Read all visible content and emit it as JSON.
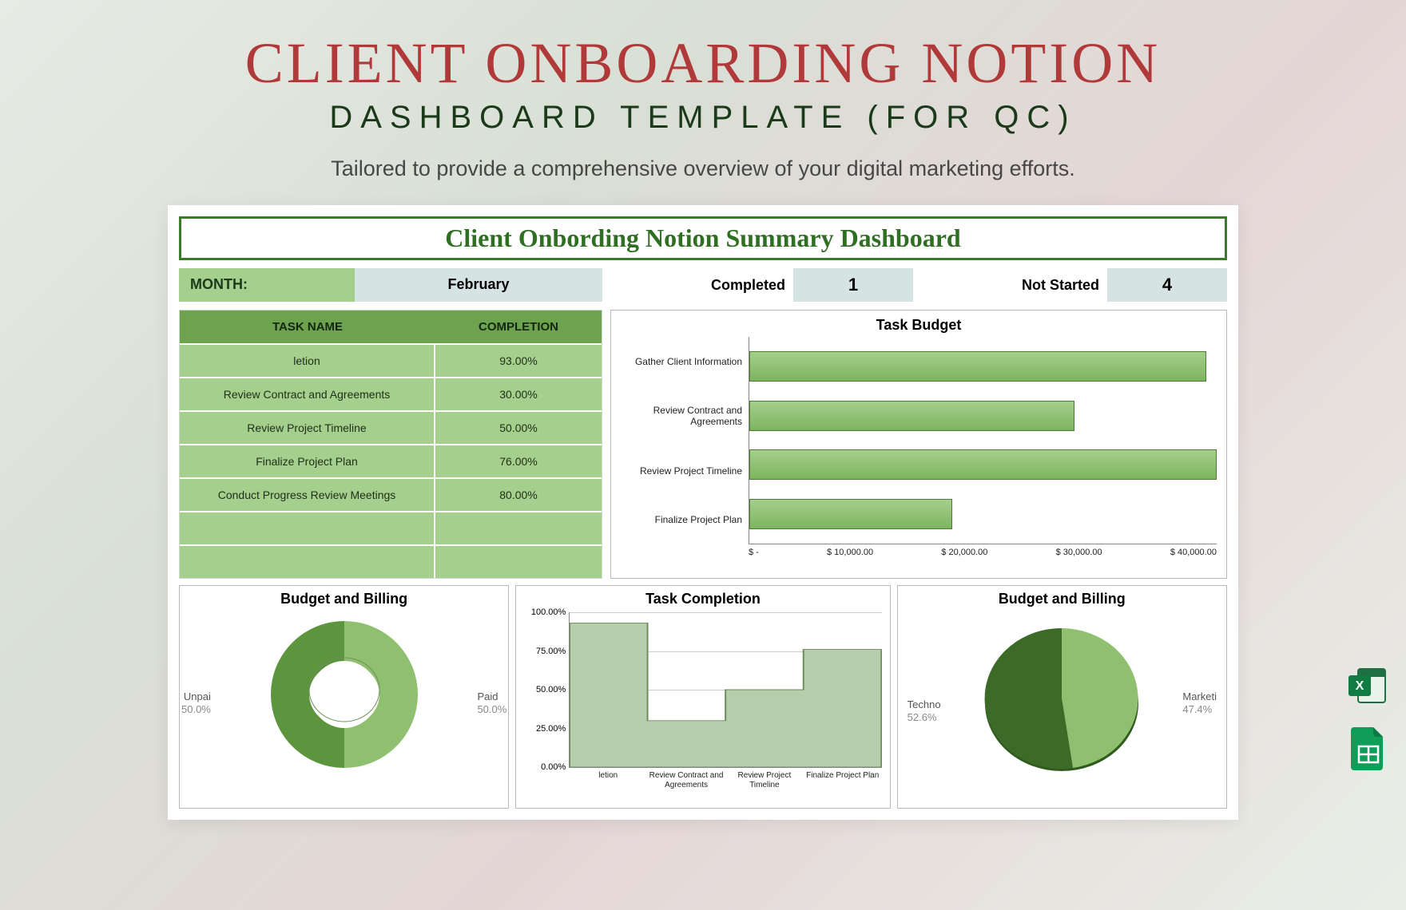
{
  "hero": {
    "title": "CLIENT ONBOARDING NOTION",
    "subtitle": "DASHBOARD TEMPLATE (FOR QC)",
    "desc": "Tailored to provide a comprehensive overview of your digital marketing efforts."
  },
  "dashboard": {
    "title": "Client Onbording Notion Summary Dashboard",
    "month_label": "MONTH:",
    "month_value": "February",
    "completed_label": "Completed",
    "completed_value": "1",
    "notstarted_label": "Not Started",
    "notstarted_value": "4",
    "table": {
      "head_name": "TASK NAME",
      "head_comp": "COMPLETION",
      "rows": [
        {
          "name": "letion",
          "comp": "93.00%"
        },
        {
          "name": "Review Contract and Agreements",
          "comp": "30.00%"
        },
        {
          "name": "Review Project Timeline",
          "comp": "50.00%"
        },
        {
          "name": "Finalize Project Plan",
          "comp": "76.00%"
        },
        {
          "name": "Conduct Progress Review Meetings",
          "comp": "80.00%"
        }
      ]
    }
  },
  "chart_data": [
    {
      "type": "bar",
      "title": "Task Budget",
      "orientation": "horizontal",
      "categories": [
        "Gather Client Information",
        "Review Contract and Agreements",
        "Review Project Timeline",
        "Finalize Project Plan"
      ],
      "values": [
        45000,
        32000,
        46000,
        20000
      ],
      "xlim": [
        0,
        46000
      ],
      "xticks": [
        "$ -",
        "$ 10,000.00",
        "$ 20,000.00",
        "$ 30,000.00",
        "$ 40,000.00"
      ]
    },
    {
      "type": "pie",
      "title": "Budget and Billing",
      "subtype": "donut",
      "series": [
        {
          "name": "Unpai",
          "value": 50.0
        },
        {
          "name": "Paid",
          "value": 50.0
        }
      ]
    },
    {
      "type": "area",
      "title": "Task Completion",
      "subtype": "step",
      "categories": [
        "letion",
        "Review Contract and Agreements",
        "Review Project Timeline",
        "Finalize Project Plan"
      ],
      "values": [
        93.0,
        30.0,
        50.0,
        76.0
      ],
      "ylim": [
        0,
        100
      ],
      "yticks": [
        "0.00%",
        "25.00%",
        "50.00%",
        "75.00%",
        "100.00%"
      ]
    },
    {
      "type": "pie",
      "title": "Budget and Billing",
      "series": [
        {
          "name": "Techno",
          "value": 52.6
        },
        {
          "name": "Marketi",
          "value": 47.4
        }
      ]
    }
  ],
  "icons": {
    "excel": "Excel",
    "sheets": "Google Sheets"
  }
}
